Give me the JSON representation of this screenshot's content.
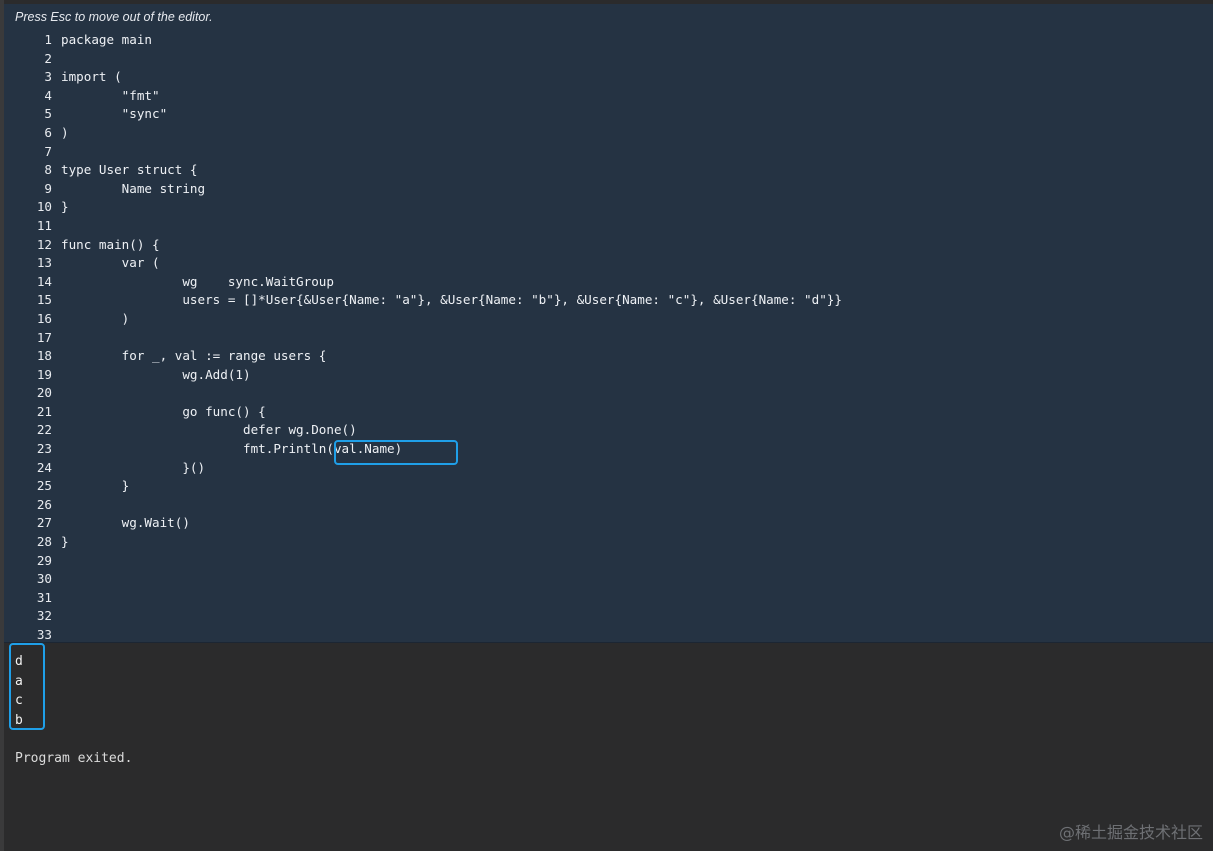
{
  "editor": {
    "hint": "Press Esc to move out of the editor.",
    "lines": [
      {
        "n": "1",
        "text": "package main"
      },
      {
        "n": "2",
        "text": ""
      },
      {
        "n": "3",
        "text": "import ("
      },
      {
        "n": "4",
        "text": "\t\"fmt\""
      },
      {
        "n": "5",
        "text": "\t\"sync\""
      },
      {
        "n": "6",
        "text": ")"
      },
      {
        "n": "7",
        "text": ""
      },
      {
        "n": "8",
        "text": "type User struct {"
      },
      {
        "n": "9",
        "text": "\tName string"
      },
      {
        "n": "10",
        "text": "}"
      },
      {
        "n": "11",
        "text": ""
      },
      {
        "n": "12",
        "text": "func main() {"
      },
      {
        "n": "13",
        "text": "\tvar ("
      },
      {
        "n": "14",
        "text": "\t\twg    sync.WaitGroup"
      },
      {
        "n": "15",
        "text": "\t\tusers = []*User{&User{Name: \"a\"}, &User{Name: \"b\"}, &User{Name: \"c\"}, &User{Name: \"d\"}}"
      },
      {
        "n": "16",
        "text": "\t)"
      },
      {
        "n": "17",
        "text": ""
      },
      {
        "n": "18",
        "text": "\tfor _, val := range users {"
      },
      {
        "n": "19",
        "text": "\t\twg.Add(1)"
      },
      {
        "n": "20",
        "text": ""
      },
      {
        "n": "21",
        "text": "\t\tgo func() {"
      },
      {
        "n": "22",
        "text": "\t\t\tdefer wg.Done()"
      },
      {
        "n": "23",
        "text": "\t\t\tfmt.Println(val.Name)"
      },
      {
        "n": "24",
        "text": "\t\t}()"
      },
      {
        "n": "25",
        "text": "\t}"
      },
      {
        "n": "26",
        "text": ""
      },
      {
        "n": "27",
        "text": "\twg.Wait()"
      },
      {
        "n": "28",
        "text": "}"
      },
      {
        "n": "29",
        "text": ""
      },
      {
        "n": "30",
        "text": ""
      },
      {
        "n": "31",
        "text": ""
      },
      {
        "n": "32",
        "text": ""
      },
      {
        "n": "33",
        "text": ""
      }
    ]
  },
  "output": {
    "lines": [
      "d",
      "a",
      "c",
      "b"
    ],
    "exit_message": "Program exited."
  },
  "watermark": "@稀土掘金技术社区",
  "colors": {
    "editor_bg": "#253343",
    "output_bg": "#2b2b2c",
    "highlight": "#1f9fe8"
  }
}
